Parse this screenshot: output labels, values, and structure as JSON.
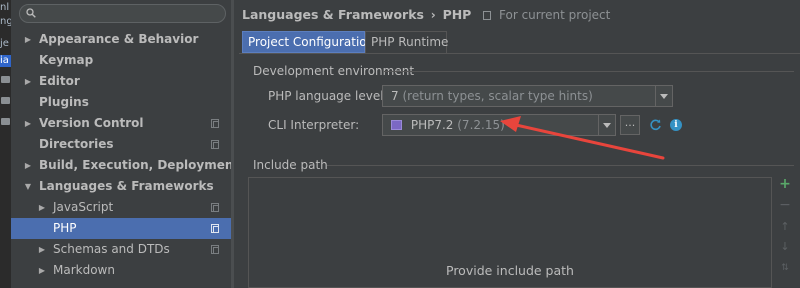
{
  "edge_strip": {
    "fragments": [
      "nl",
      "ng",
      "je",
      "ia"
    ]
  },
  "sidebar": {
    "search": {
      "value": "",
      "placeholder": ""
    },
    "items": [
      {
        "label": "Appearance & Behavior",
        "arrow": "▶",
        "bold": true,
        "copy": false,
        "selected": false
      },
      {
        "label": "Keymap",
        "arrow": "",
        "bold": true,
        "copy": false,
        "selected": false
      },
      {
        "label": "Editor",
        "arrow": "▶",
        "bold": true,
        "copy": false,
        "selected": false
      },
      {
        "label": "Plugins",
        "arrow": "",
        "bold": true,
        "copy": false,
        "selected": false
      },
      {
        "label": "Version Control",
        "arrow": "▶",
        "bold": true,
        "copy": true,
        "selected": false
      },
      {
        "label": "Directories",
        "arrow": "",
        "bold": true,
        "copy": true,
        "selected": false
      },
      {
        "label": "Build, Execution, Deployment",
        "arrow": "▶",
        "bold": true,
        "copy": false,
        "selected": false
      },
      {
        "label": "Languages & Frameworks",
        "arrow": "▼",
        "bold": true,
        "copy": false,
        "selected": false
      },
      {
        "label": "JavaScript",
        "arrow": "▶",
        "bold": false,
        "copy": true,
        "selected": false
      },
      {
        "label": "PHP",
        "arrow": "",
        "bold": false,
        "copy": true,
        "selected": true
      },
      {
        "label": "Schemas and DTDs",
        "arrow": "▶",
        "bold": false,
        "copy": true,
        "selected": false
      },
      {
        "label": "Markdown",
        "arrow": "▶",
        "bold": false,
        "copy": false,
        "selected": false
      }
    ]
  },
  "breadcrumb": {
    "path1": "Languages & Frameworks",
    "separator": "›",
    "path2": "PHP",
    "scope": "For current project"
  },
  "tabs": [
    {
      "label": "Project Configuration",
      "active": true
    },
    {
      "label": "PHP Runtime",
      "active": false
    }
  ],
  "dev_env": {
    "title": "Development environment",
    "language_level_label": "PHP language level:",
    "language_level_value": "7",
    "language_level_hint": "(return types, scalar type hints)",
    "cli_label": "CLI Interpreter:",
    "cli_value": "PHP7.2",
    "cli_hint": "(7.2.15)",
    "dots_label": "..."
  },
  "include_path": {
    "title": "Include path",
    "empty_text": "Provide include path"
  },
  "colors": {
    "accent": "#4b6eaf",
    "annotation_arrow": "#e8453c",
    "add": "#59a869",
    "info": "#3592c4"
  }
}
